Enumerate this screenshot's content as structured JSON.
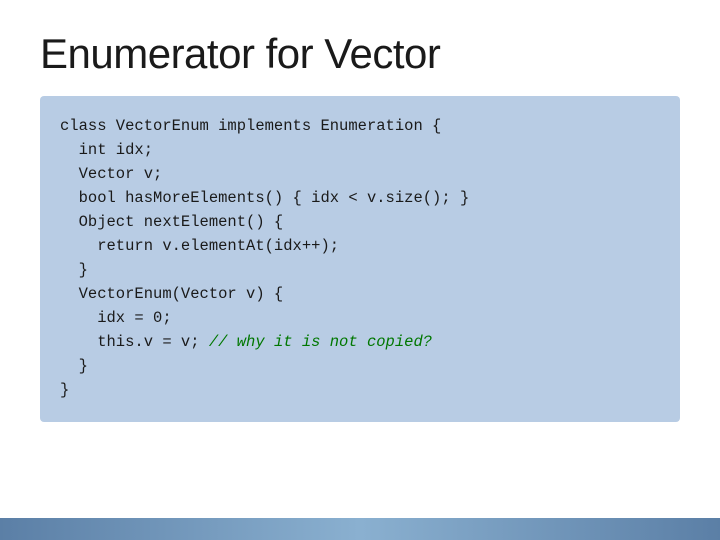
{
  "slide": {
    "title": "Enumerator for Vector",
    "code": {
      "lines": [
        {
          "id": 1,
          "text": "class VectorEnum implements Enumeration {",
          "type": "normal"
        },
        {
          "id": 2,
          "text": "  int idx;",
          "type": "normal"
        },
        {
          "id": 3,
          "text": "  Vector v;",
          "type": "normal"
        },
        {
          "id": 4,
          "text": "  bool hasMoreElements() { idx < v.size(); }",
          "type": "normal"
        },
        {
          "id": 5,
          "text": "  Object nextElement() {",
          "type": "normal"
        },
        {
          "id": 6,
          "text": "    return v.elementAt(idx++);",
          "type": "normal"
        },
        {
          "id": 7,
          "text": "  }",
          "type": "normal"
        },
        {
          "id": 8,
          "text": "  VectorEnum(Vector v) {",
          "type": "normal"
        },
        {
          "id": 9,
          "text": "    idx = 0;",
          "type": "normal"
        },
        {
          "id": 10,
          "text": "    this.v = v; // why it is not copied?",
          "type": "comment"
        },
        {
          "id": 11,
          "text": "  }",
          "type": "normal"
        },
        {
          "id": 12,
          "text": "}",
          "type": "normal"
        }
      ]
    }
  }
}
